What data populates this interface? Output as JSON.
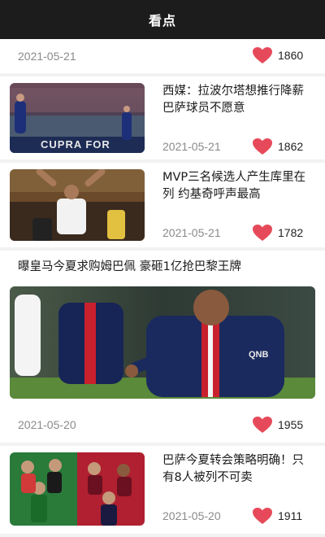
{
  "header": {
    "title": "看点"
  },
  "colors": {
    "accent_heart": "#e64a5a",
    "topbar": "#1c1c1c"
  },
  "icons": {
    "like": "heart-icon"
  },
  "feed": [
    {
      "date": "2021-05-21",
      "likes": "1860"
    },
    {
      "title": "西媒：拉波尔塔想推行降薪 巴萨球员不愿意",
      "date": "2021-05-21",
      "likes": "1862",
      "thumb_text": "CUPRA FOR"
    },
    {
      "title": "MVP三名候选人产生库里在列 约基奇呼声最高",
      "date": "2021-05-21",
      "likes": "1782"
    },
    {
      "title": "曝皇马今夏求购姆巴佩 豪砸1亿抢巴黎王牌",
      "date": "2021-05-20",
      "likes": "1955",
      "thumb_text": "QNB"
    },
    {
      "title": "巴萨今夏转会策略明确！只有8人被列不可卖",
      "date": "2021-05-20",
      "likes": "1911"
    }
  ]
}
